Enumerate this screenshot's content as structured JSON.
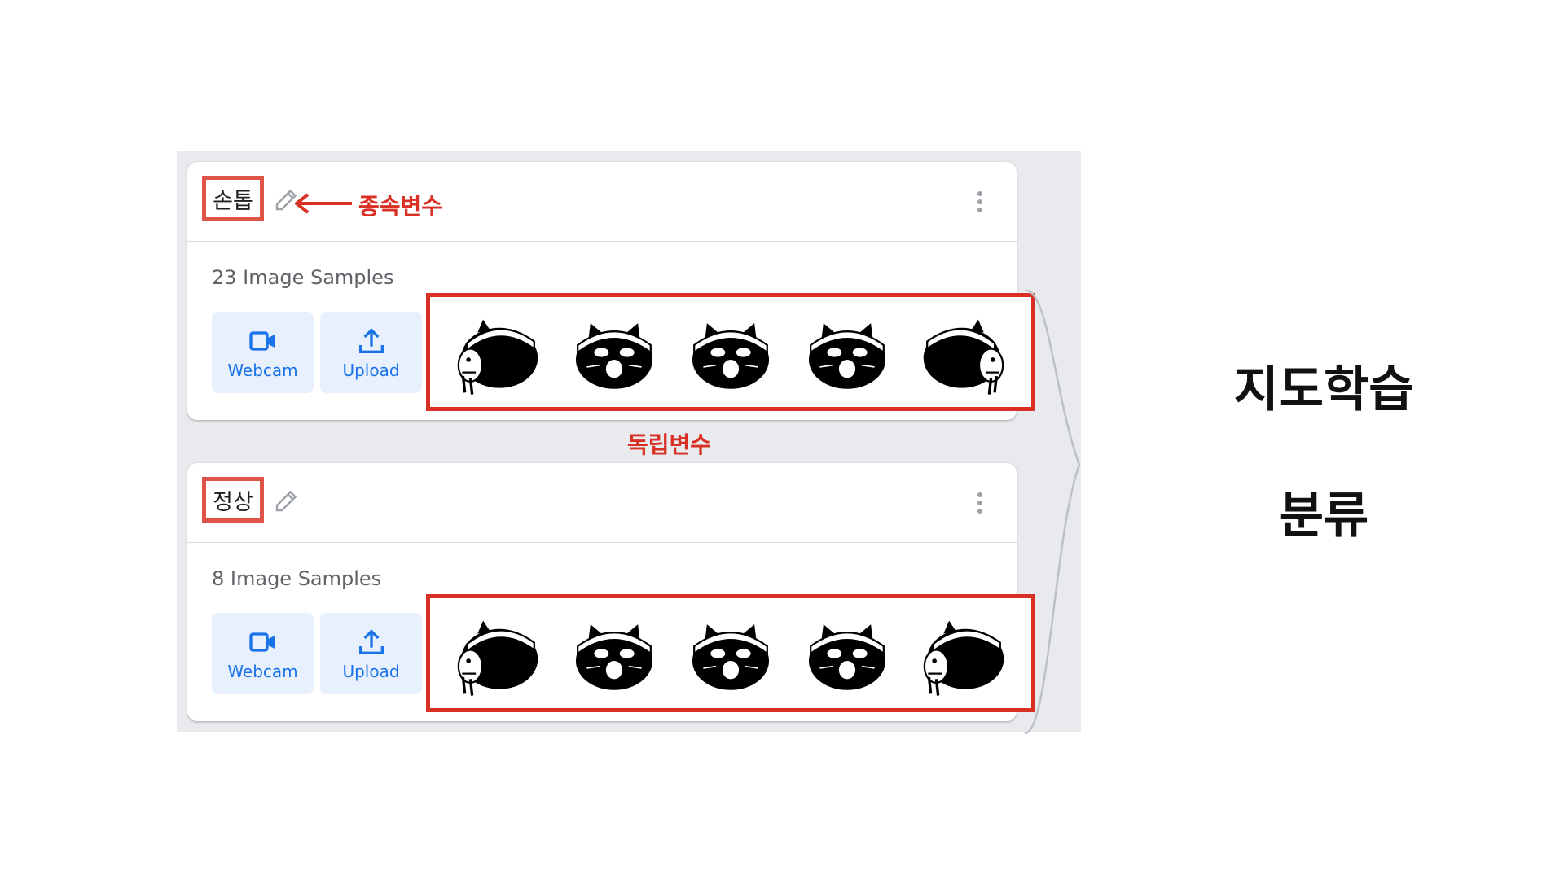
{
  "classes": [
    {
      "name": "손톱",
      "samples_text": "23 Image Samples",
      "webcam_label": "Webcam",
      "upload_label": "Upload"
    },
    {
      "name": "정상",
      "samples_text": "8 Image Samples",
      "webcam_label": "Webcam",
      "upload_label": "Upload"
    }
  ],
  "annotations": {
    "dependent_variable": "종속변수",
    "independent_variable": "독립변수"
  },
  "side_labels": {
    "supervised_learning": "지도학습",
    "classification": "분류"
  },
  "colors": {
    "annotation_red": "#d93025",
    "button_bg": "#e8f0fe",
    "button_text": "#1a73e8",
    "panel_bg": "#e8eaed"
  },
  "icons": {
    "edit": "pencil-icon",
    "more": "more-vert-icon",
    "webcam": "videocam-icon",
    "upload": "upload-icon"
  }
}
